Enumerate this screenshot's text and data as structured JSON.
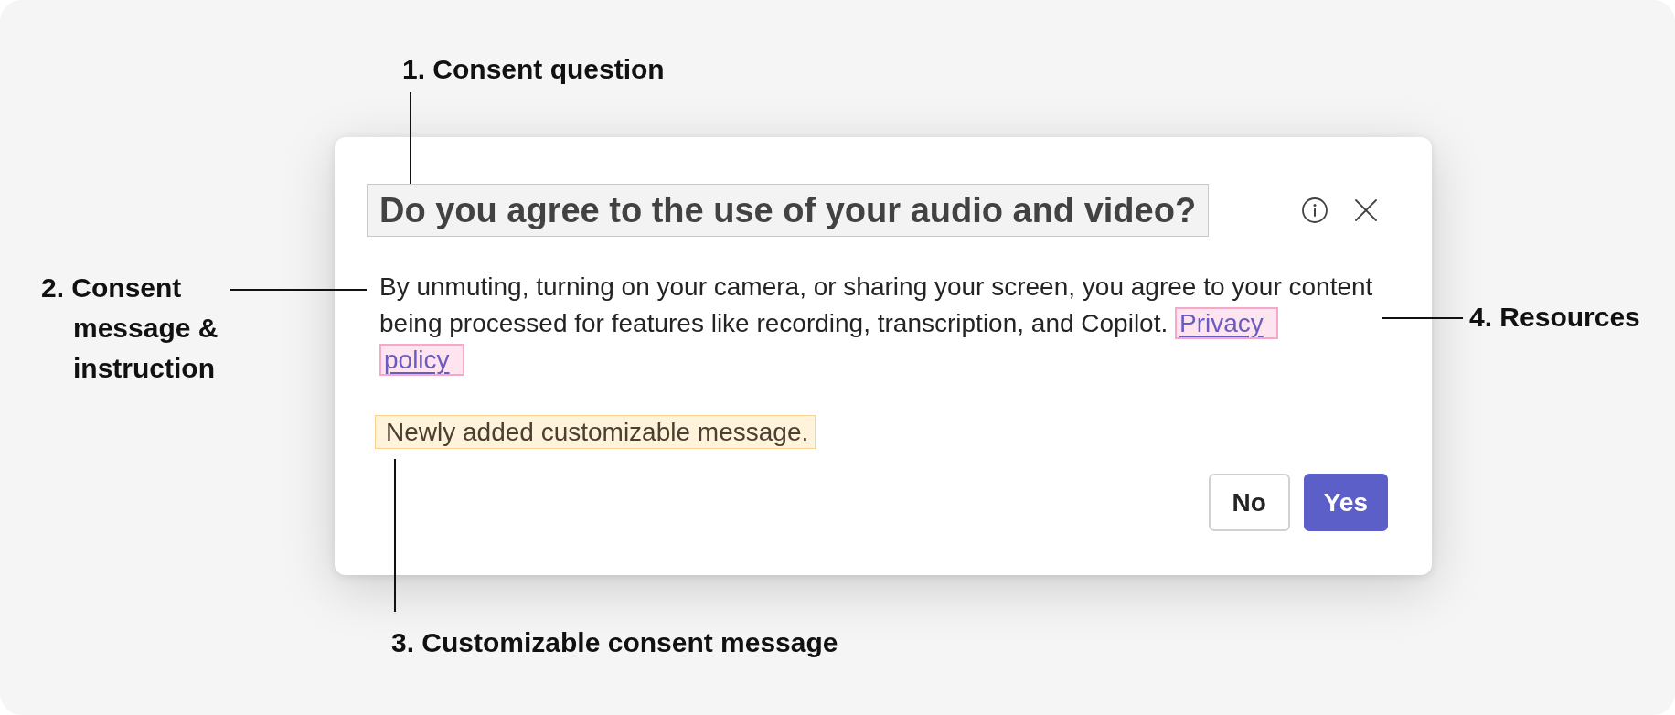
{
  "annotations": [
    {
      "text": "1. Consent question"
    },
    {
      "text": "2. Consent message & instruction"
    },
    {
      "text": "3. Customizable consent message"
    },
    {
      "text": "4. Resources"
    }
  ],
  "dialog": {
    "title": "Do you agree to the use of your audio and video?",
    "message": "By unmuting, turning on your camera, or sharing your screen, you agree to your content being processed for features like recording, transcription, and Copilot.",
    "link": "Privacy policy",
    "custom_message": "Newly added customizable message.",
    "buttons": [
      {
        "label": "No",
        "kind": "secondary"
      },
      {
        "label": "Yes",
        "kind": "primary"
      }
    ]
  }
}
